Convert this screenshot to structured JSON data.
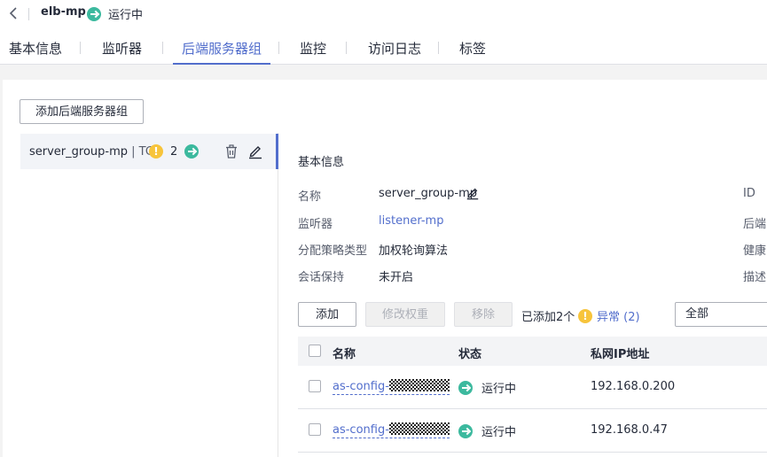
{
  "header": {
    "title": "elb-mp",
    "status": "运行中"
  },
  "tabs": [
    {
      "label": "基本信息"
    },
    {
      "label": "监听器"
    },
    {
      "label": "后端服务器组"
    },
    {
      "label": "监控"
    },
    {
      "label": "访问日志"
    },
    {
      "label": "标签"
    }
  ],
  "toolbar": {
    "add_group_label": "添加后端服务器组"
  },
  "server_group": {
    "name": "server_group-mp",
    "protocol": "| TCP",
    "warning_count": "2"
  },
  "basic_info": {
    "section_title": "基本信息",
    "name_label": "名称",
    "name_value": "server_group-mp",
    "listener_label": "监听器",
    "listener_value": "listener-mp",
    "algorithm_label": "分配策略类型",
    "algorithm_value": "加权轮询算法",
    "session_label": "会话保持",
    "session_value": "未开启",
    "id_label": "ID",
    "backend_label": "后端",
    "health_label": "健康",
    "desc_label": "描述"
  },
  "actions": {
    "add_label": "添加",
    "modify_weight_label": "修改权重",
    "remove_label": "移除",
    "added_text": "已添加2个",
    "abnormal_text": "异常 (2)",
    "filter_value": "全部"
  },
  "table": {
    "columns": [
      "名称",
      "状态",
      "私网IP地址"
    ],
    "rows": [
      {
        "name": "as-config-",
        "status": "运行中",
        "ip": "192.168.0.200"
      },
      {
        "name": "as-config-",
        "status": "运行中",
        "ip": "192.168.0.47"
      }
    ]
  }
}
